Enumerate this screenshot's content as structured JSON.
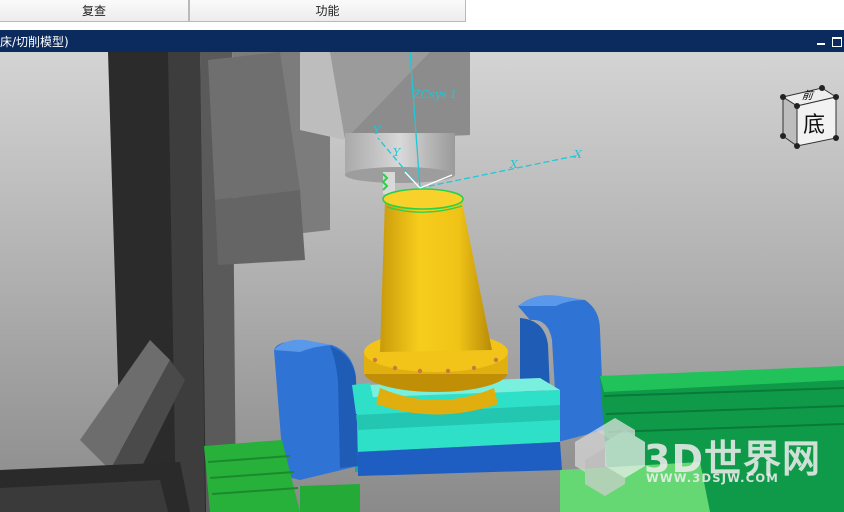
{
  "tabs": [
    {
      "label": "复查"
    },
    {
      "label": "功能"
    }
  ],
  "window": {
    "title": "床/切削模型)"
  },
  "viewport": {
    "csys_label": "ZCsys 1",
    "axis_x1": "X",
    "axis_x2": "X",
    "axis_y1": "Y",
    "axis_y2": "Y",
    "view_cube": {
      "top_label": "前",
      "front_label": "底"
    }
  },
  "watermark": {
    "brand": "3D世界网",
    "url": "WWW.3DSJW.COM"
  },
  "colors": {
    "title_bar": "#0b2a5e",
    "workpiece": "#f0c417",
    "fixture": "#2f74d4",
    "fixture_base": "#2fe0c8",
    "table": "#1fa845",
    "csys": "#1fc8d6"
  }
}
